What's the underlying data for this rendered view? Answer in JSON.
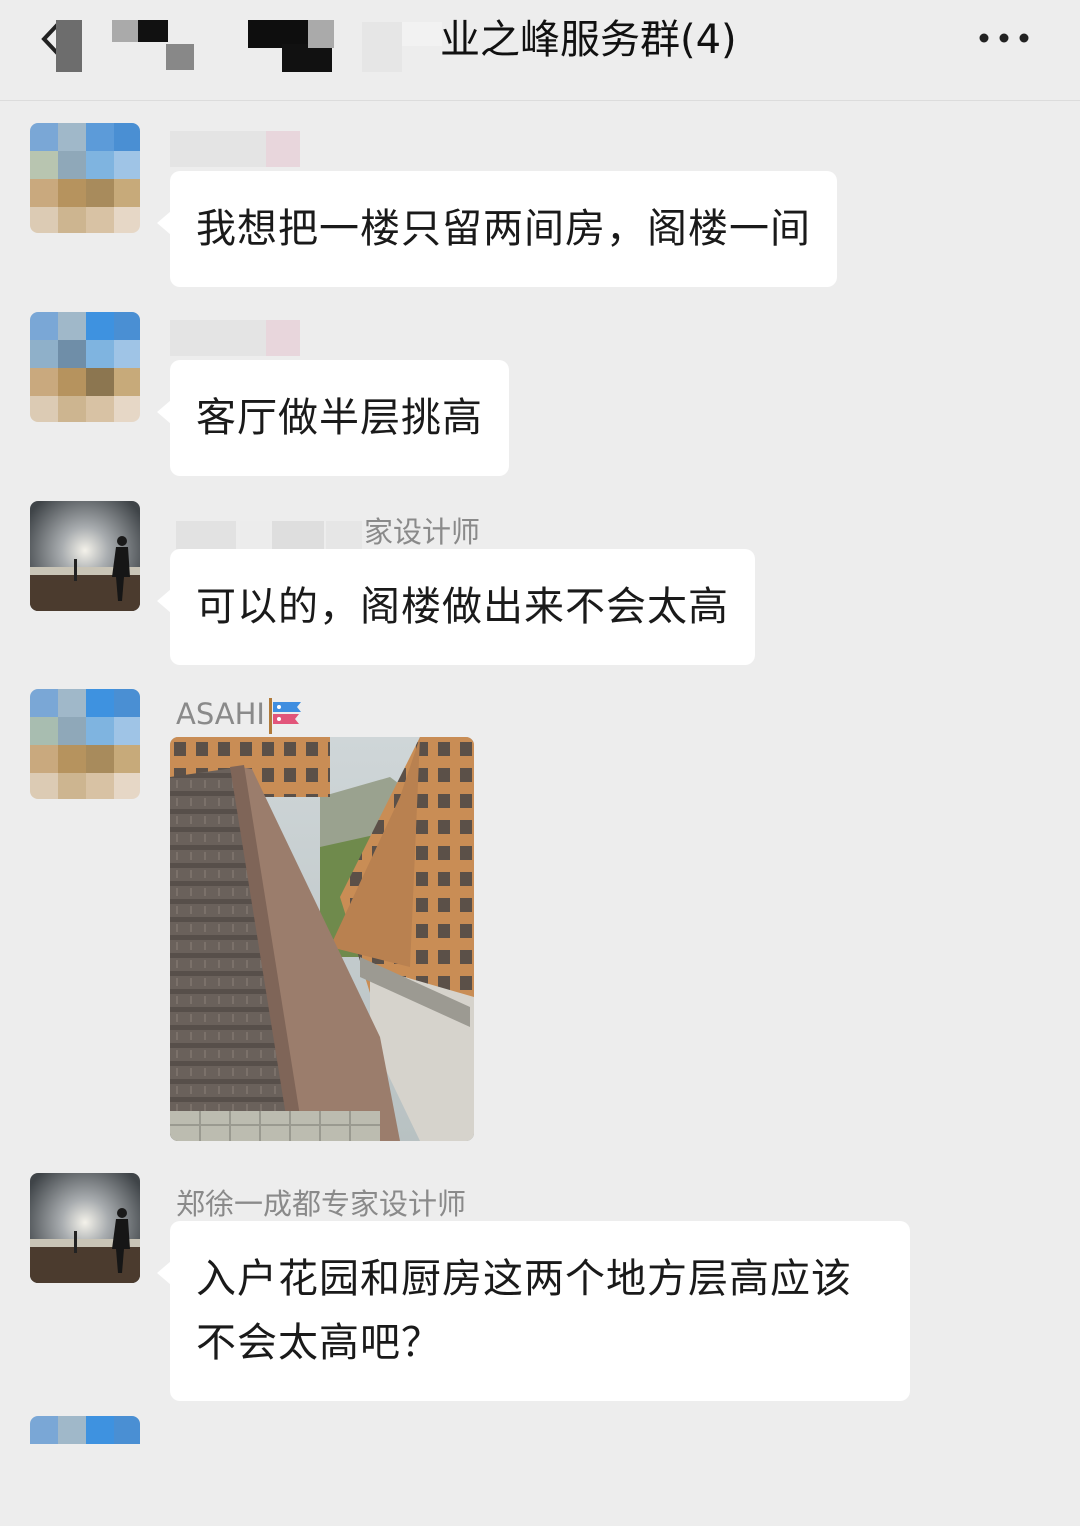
{
  "header": {
    "title": "业之峰服务群(4)",
    "back_icon": "chevron-left-icon",
    "more_icon": "more-dots-icon"
  },
  "messages": [
    {
      "sender": "ASAHI",
      "text": "我想把一楼只留两间房，阁楼一间"
    },
    {
      "sender": "ASAHI",
      "text": "客厅做半层挑高"
    },
    {
      "sender": "家设计师",
      "text": "可以的，阁楼做出来不会太高"
    },
    {
      "sender": "ASAHI",
      "image": "roof-photo"
    },
    {
      "sender": "郑徐一成都专家设计师",
      "text": "入户花园和厨房这两个地方层高应该不会太高吧？"
    }
  ],
  "colors": {
    "background": "#ededed",
    "bubble": "#ffffff",
    "sender_text": "#8a8a8a"
  }
}
